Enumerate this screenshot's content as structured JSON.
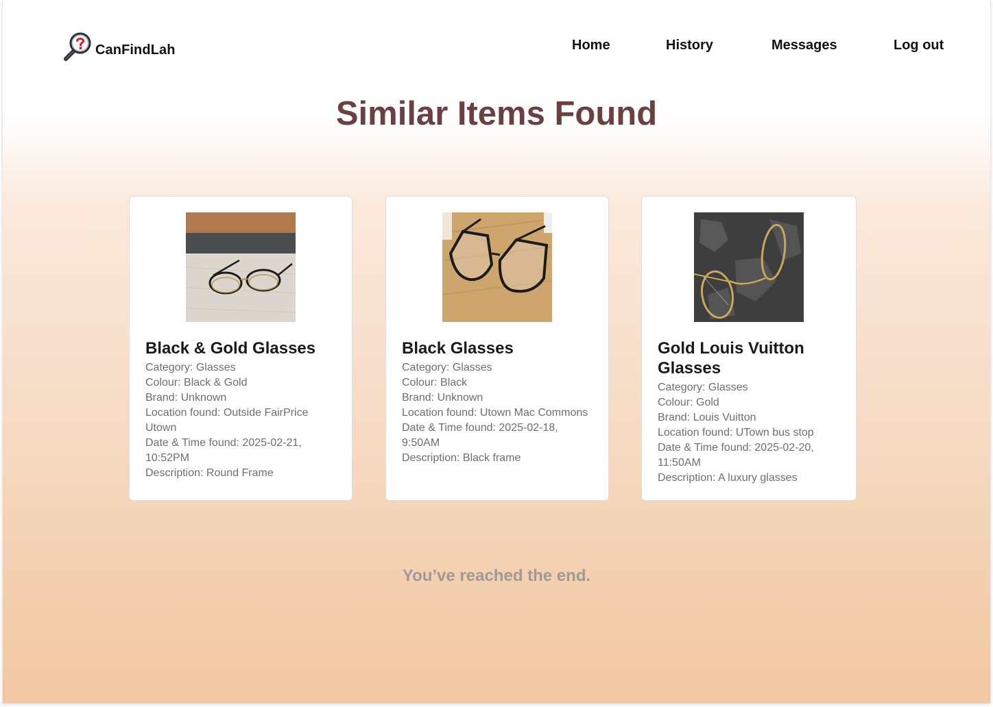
{
  "header": {
    "brand": "CanFindLah",
    "nav": {
      "home": "Home",
      "history": "History",
      "messages": "Messages",
      "logout": "Log out"
    }
  },
  "page": {
    "title": "Similar Items Found",
    "end_message": "You’ve reached the end."
  },
  "items": [
    {
      "title": "Black & Gold Glasses",
      "image": "glasses-photo-1",
      "details": [
        "Category: Glasses",
        "Colour: Black & Gold",
        "Brand: Unknown",
        "Location found: Outside FairPrice Utown",
        "Date & Time found: 2025-02-21, 10:52PM",
        "Description: Round Frame"
      ]
    },
    {
      "title": "Black Glasses",
      "image": "glasses-photo-2",
      "details": [
        "Category: Glasses",
        "Colour: Black",
        "Brand: Unknown",
        "Location found: Utown Mac Commons",
        "Date & Time found: 2025-02-18, 9:50AM",
        "Description: Black frame"
      ]
    },
    {
      "title": "Gold Louis Vuitton Glasses",
      "image": "glasses-photo-3",
      "details": [
        "Category: Glasses",
        "Colour: Gold",
        "Brand: Louis Vuitton",
        "Location found: UTown bus stop",
        "Date & Time found: 2025-02-20, 11:50AM",
        "Description: A luxury glasses"
      ]
    }
  ],
  "colors": {
    "title": "#6b4040",
    "gradient_bottom": "#f2c7a1",
    "end_message": "#9d9a97"
  }
}
